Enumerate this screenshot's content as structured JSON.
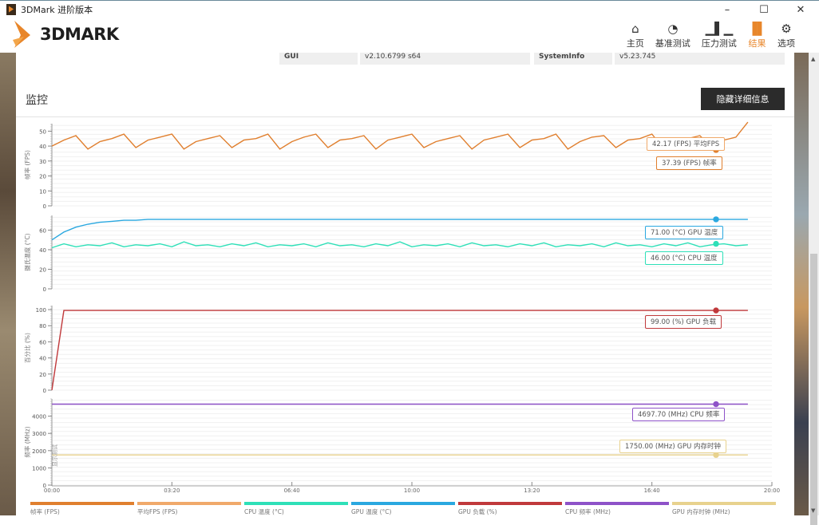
{
  "window": {
    "title": "3DMark 进阶版本",
    "minimize": "–",
    "maximize": "☐",
    "close": "✕"
  },
  "header": {
    "logo": "3DMARK",
    "nav": [
      {
        "label": "主页",
        "icon": "home-icon",
        "glyph": "⌂"
      },
      {
        "label": "基准测试",
        "icon": "gauge-icon",
        "glyph": "◔"
      },
      {
        "label": "压力测试",
        "icon": "bar-chart-icon",
        "glyph": "▁▌▁"
      },
      {
        "label": "结果",
        "icon": "results-icon",
        "glyph": "▐▌",
        "active": true
      },
      {
        "label": "选项",
        "icon": "gear-icon",
        "glyph": "⚙"
      }
    ],
    "accent": "#e8862a"
  },
  "info": {
    "gui_label": "GUI",
    "gui_value": "v2.10.6799 s64",
    "sysinfo_label": "SystemInfo",
    "sysinfo_value": "v5.23.745"
  },
  "monitor": {
    "title": "监控",
    "hide_button": "隐藏详细信息"
  },
  "chart_data": {
    "type": "line",
    "x_ticks": [
      "00:00",
      "03:20",
      "06:40",
      "10:00",
      "13:20",
      "16:40",
      "20:00"
    ],
    "xlim": [
      0,
      1200
    ],
    "sample_interval_s": 20,
    "side_label": "显示测试",
    "panels": [
      {
        "ylabel": "帧率 (FPS)",
        "ylim": [
          0,
          55
        ],
        "ticks": [
          0,
          10,
          20,
          30,
          40,
          50
        ],
        "series": [
          {
            "name": "帧率 (FPS)",
            "color": "#e07f2e",
            "values": [
              40,
              44,
              47,
              38,
              43,
              45,
              48,
              39,
              44,
              46,
              48,
              38,
              43,
              45,
              47,
              39,
              44,
              45,
              48,
              38,
              43,
              46,
              48,
              39,
              44,
              45,
              47,
              38,
              44,
              46,
              48,
              39,
              43,
              45,
              47,
              38,
              44,
              46,
              48,
              39,
              44,
              45,
              48,
              38,
              43,
              46,
              47,
              39,
              44,
              45,
              48,
              38,
              43,
              45,
              47,
              39,
              44,
              46,
              56
            ]
          }
        ],
        "markers": [
          {
            "text": "42.17 (FPS) 平均FPS",
            "color": "#f0a96a",
            "value": 42.17
          },
          {
            "text": "37.39 (FPS) 帧率",
            "color": "#e07f2e",
            "value": 37.39
          }
        ]
      },
      {
        "ylabel": "摄氏温度 (°C)",
        "ylim": [
          0,
          75
        ],
        "ticks": [
          0,
          20,
          40,
          60
        ],
        "series": [
          {
            "name": "GPU 温度 (°C)",
            "color": "#2aa8e0",
            "values": [
              50,
              58,
              63,
              66,
              68,
              69,
              70,
              70,
              71,
              71,
              71,
              71,
              71,
              71,
              71,
              71,
              71,
              71,
              71,
              71,
              71,
              71,
              71,
              71,
              71,
              71,
              71,
              71,
              71,
              71,
              71,
              71,
              71,
              71,
              71,
              71,
              71,
              71,
              71,
              71,
              71,
              71,
              71,
              71,
              71,
              71,
              71,
              71,
              71,
              71,
              71,
              71,
              71,
              71,
              71,
              71,
              71,
              71,
              71
            ]
          },
          {
            "name": "CPU 温度 (°C)",
            "color": "#2ee0b8",
            "values": [
              42,
              46,
              43,
              45,
              44,
              47,
              43,
              45,
              44,
              46,
              43,
              48,
              44,
              45,
              43,
              46,
              44,
              47,
              43,
              45,
              44,
              46,
              43,
              47,
              44,
              45,
              43,
              46,
              44,
              48,
              43,
              45,
              44,
              46,
              43,
              47,
              44,
              45,
              43,
              46,
              44,
              47,
              43,
              45,
              44,
              46,
              43,
              47,
              44,
              45,
              43,
              46,
              44,
              47,
              43,
              45,
              46,
              44,
              45
            ]
          }
        ],
        "markers": [
          {
            "text": "71.00 (°C) GPU 温度",
            "color": "#2aa8e0",
            "value": 71
          },
          {
            "text": "46.00 (°C) CPU 温度",
            "color": "#2ee0b8",
            "value": 46
          }
        ]
      },
      {
        "ylabel": "百分比 (%)",
        "ylim": [
          0,
          105
        ],
        "ticks": [
          0,
          20,
          40,
          60,
          80,
          100
        ],
        "series": [
          {
            "name": "GPU 负载 (%)",
            "color": "#c0393b",
            "values": [
              0,
              99,
              99,
              99,
              99,
              99,
              99,
              99,
              99,
              99,
              99,
              99,
              99,
              99,
              99,
              99,
              99,
              99,
              99,
              99,
              99,
              99,
              99,
              99,
              99,
              99,
              99,
              99,
              99,
              99,
              99,
              99,
              99,
              99,
              99,
              99,
              99,
              99,
              99,
              99,
              99,
              99,
              99,
              99,
              99,
              99,
              99,
              99,
              99,
              99,
              99,
              99,
              99,
              99,
              99,
              99,
              99,
              99,
              99
            ]
          }
        ],
        "markers": [
          {
            "text": "99.00 (%) GPU 负载",
            "color": "#c0393b",
            "value": 99
          }
        ]
      },
      {
        "ylabel": "频率 (MHz)",
        "ylim": [
          0,
          5000
        ],
        "ticks": [
          0,
          1000,
          2000,
          3000,
          4000
        ],
        "series": [
          {
            "name": "CPU 频率 (MHz)",
            "color": "#8e52c8",
            "values": [
              4697.7,
              4697.7,
              4697.7,
              4697.7,
              4697.7,
              4697.7,
              4697.7,
              4697.7,
              4697.7,
              4697.7,
              4697.7,
              4697.7,
              4697.7,
              4697.7,
              4697.7,
              4697.7,
              4697.7,
              4697.7,
              4697.7,
              4697.7,
              4697.7,
              4697.7,
              4697.7,
              4697.7,
              4697.7,
              4697.7,
              4697.7,
              4697.7,
              4697.7,
              4697.7,
              4697.7,
              4697.7,
              4697.7,
              4697.7,
              4697.7,
              4697.7,
              4697.7,
              4697.7,
              4697.7,
              4697.7,
              4697.7,
              4697.7,
              4697.7,
              4697.7,
              4697.7,
              4697.7,
              4697.7,
              4697.7,
              4697.7,
              4697.7,
              4697.7,
              4697.7,
              4697.7,
              4697.7,
              4697.7,
              4697.7,
              4697.7,
              4697.7,
              4697.7
            ]
          },
          {
            "name": "GPU 内存时钟 (MHz)",
            "color": "#e8d28e",
            "values": [
              1750,
              1750,
              1750,
              1750,
              1750,
              1750,
              1750,
              1750,
              1750,
              1750,
              1750,
              1750,
              1750,
              1750,
              1750,
              1750,
              1750,
              1750,
              1750,
              1750,
              1750,
              1750,
              1750,
              1750,
              1750,
              1750,
              1750,
              1750,
              1750,
              1750,
              1750,
              1750,
              1750,
              1750,
              1750,
              1750,
              1750,
              1750,
              1750,
              1750,
              1750,
              1750,
              1750,
              1750,
              1750,
              1750,
              1750,
              1750,
              1750,
              1750,
              1750,
              1750,
              1750,
              1750,
              1750,
              1750,
              1750,
              1750,
              1750
            ]
          }
        ],
        "markers": [
          {
            "text": "4697.70 (MHz) CPU 频率",
            "color": "#8e52c8",
            "value": 4697.7
          },
          {
            "text": "1750.00 (MHz) GPU 内存时钟",
            "color": "#e8d28e",
            "value": 1750
          }
        ]
      }
    ],
    "legend": [
      {
        "label": "帧率 (FPS)",
        "color": "#e07f2e"
      },
      {
        "label": "平均FPS (FPS)",
        "color": "#f0a96a"
      },
      {
        "label": "CPU 温度 (°C)",
        "color": "#2ee0b8"
      },
      {
        "label": "GPU 温度 (°C)",
        "color": "#2aa8e0"
      },
      {
        "label": "GPU 负载 (%)",
        "color": "#c0393b"
      },
      {
        "label": "CPU 频率 (MHz)",
        "color": "#8e52c8"
      },
      {
        "label": "GPU 内存时钟 (MHz)",
        "color": "#e8d28e"
      }
    ]
  }
}
